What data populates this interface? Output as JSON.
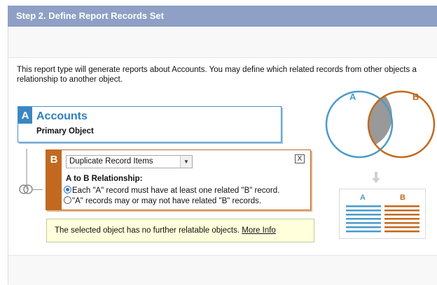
{
  "header": {
    "title": "Step 2. Define Report Records Set"
  },
  "description": {
    "line1": "This report type will generate reports about Accounts. You may define which related records from other objects a",
    "line2": "relationship to another object."
  },
  "object_a": {
    "letter": "A",
    "name": "Accounts",
    "subtitle": "Primary Object"
  },
  "object_b": {
    "letter": "B",
    "selected_object": "Duplicate Record Items",
    "close_label": "X",
    "relationship_title": "A to B Relationship:",
    "options": [
      {
        "label": "Each \"A\" record must have at least one related \"B\" record.",
        "checked": true
      },
      {
        "label": "\"A\" records may or may not have related \"B\" records.",
        "checked": false
      }
    ]
  },
  "notice": {
    "text": "The selected object has no further relatable objects.",
    "link": "More Info"
  },
  "venn_diagram": {
    "label_a": "A",
    "label_b": "B",
    "color_a": "#4a9bc9",
    "color_b": "#c2691f",
    "overlap_color": "#999999"
  },
  "table_diagram": {
    "label_a": "A",
    "label_b": "B"
  },
  "colors": {
    "header_bg": "#8fa0c6",
    "accent_a": "#3b86c2",
    "accent_b": "#c2691f",
    "notice_bg": "#ffffdc"
  }
}
